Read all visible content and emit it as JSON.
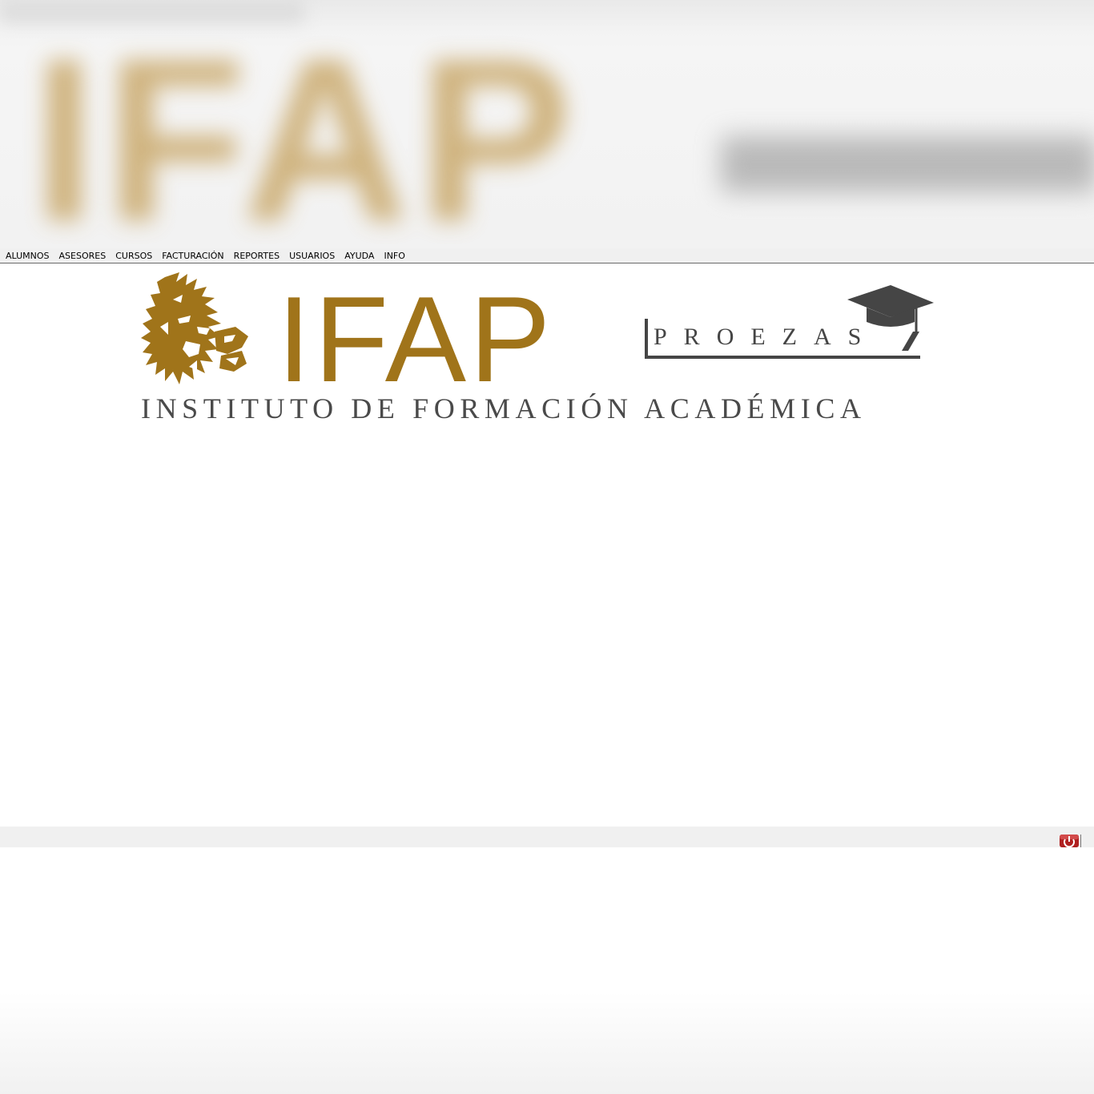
{
  "background": {
    "banner_text": "IFAP"
  },
  "menu": {
    "items": [
      {
        "label": "ALUMNOS"
      },
      {
        "label": "ASESORES"
      },
      {
        "label": "CURSOS"
      },
      {
        "label": "FACTURACIÓN"
      },
      {
        "label": "REPORTES"
      },
      {
        "label": "USUARIOS"
      },
      {
        "label": "AYUDA"
      },
      {
        "label": "INFO"
      }
    ]
  },
  "logo": {
    "name": "IFAP",
    "brand": "PROEZAS",
    "subtitle": "INSTITUTO DE FORMACIÓN ACADÉMICA",
    "gold_color": "#a0741a",
    "gray_color": "#454545"
  },
  "statusbar": {
    "power_icon": "power-icon",
    "power_color": "#b02020"
  }
}
